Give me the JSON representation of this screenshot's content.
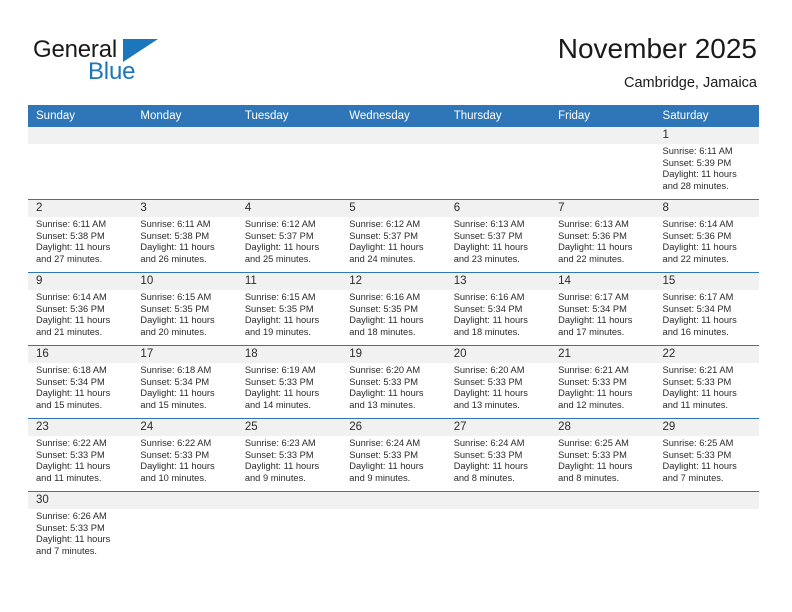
{
  "logo": {
    "word_one": "General",
    "word_two": "Blue",
    "triangle_color": "#1b76bc"
  },
  "header": {
    "title": "November 2025",
    "subtitle": "Cambridge, Jamaica",
    "accent_color": "#2e76b8",
    "band_color": "#f1f1f1"
  },
  "weekdays": [
    "Sunday",
    "Monday",
    "Tuesday",
    "Wednesday",
    "Thursday",
    "Friday",
    "Saturday"
  ],
  "labels": {
    "sunrise": "Sunrise:",
    "sunset": "Sunset:",
    "daylight": "Daylight:"
  },
  "weeks": [
    [
      {
        "day": "",
        "empty": true
      },
      {
        "day": "",
        "empty": true
      },
      {
        "day": "",
        "empty": true
      },
      {
        "day": "",
        "empty": true
      },
      {
        "day": "",
        "empty": true
      },
      {
        "day": "",
        "empty": true
      },
      {
        "day": "1",
        "sunrise": "Sunrise: 6:11 AM",
        "sunset": "Sunset: 5:39 PM",
        "daylight_a": "Daylight: 11 hours",
        "daylight_b": "and 28 minutes."
      }
    ],
    [
      {
        "day": "2",
        "sunrise": "Sunrise: 6:11 AM",
        "sunset": "Sunset: 5:38 PM",
        "daylight_a": "Daylight: 11 hours",
        "daylight_b": "and 27 minutes."
      },
      {
        "day": "3",
        "sunrise": "Sunrise: 6:11 AM",
        "sunset": "Sunset: 5:38 PM",
        "daylight_a": "Daylight: 11 hours",
        "daylight_b": "and 26 minutes."
      },
      {
        "day": "4",
        "sunrise": "Sunrise: 6:12 AM",
        "sunset": "Sunset: 5:37 PM",
        "daylight_a": "Daylight: 11 hours",
        "daylight_b": "and 25 minutes."
      },
      {
        "day": "5",
        "sunrise": "Sunrise: 6:12 AM",
        "sunset": "Sunset: 5:37 PM",
        "daylight_a": "Daylight: 11 hours",
        "daylight_b": "and 24 minutes."
      },
      {
        "day": "6",
        "sunrise": "Sunrise: 6:13 AM",
        "sunset": "Sunset: 5:37 PM",
        "daylight_a": "Daylight: 11 hours",
        "daylight_b": "and 23 minutes."
      },
      {
        "day": "7",
        "sunrise": "Sunrise: 6:13 AM",
        "sunset": "Sunset: 5:36 PM",
        "daylight_a": "Daylight: 11 hours",
        "daylight_b": "and 22 minutes."
      },
      {
        "day": "8",
        "sunrise": "Sunrise: 6:14 AM",
        "sunset": "Sunset: 5:36 PM",
        "daylight_a": "Daylight: 11 hours",
        "daylight_b": "and 22 minutes."
      }
    ],
    [
      {
        "day": "9",
        "sunrise": "Sunrise: 6:14 AM",
        "sunset": "Sunset: 5:36 PM",
        "daylight_a": "Daylight: 11 hours",
        "daylight_b": "and 21 minutes."
      },
      {
        "day": "10",
        "sunrise": "Sunrise: 6:15 AM",
        "sunset": "Sunset: 5:35 PM",
        "daylight_a": "Daylight: 11 hours",
        "daylight_b": "and 20 minutes."
      },
      {
        "day": "11",
        "sunrise": "Sunrise: 6:15 AM",
        "sunset": "Sunset: 5:35 PM",
        "daylight_a": "Daylight: 11 hours",
        "daylight_b": "and 19 minutes."
      },
      {
        "day": "12",
        "sunrise": "Sunrise: 6:16 AM",
        "sunset": "Sunset: 5:35 PM",
        "daylight_a": "Daylight: 11 hours",
        "daylight_b": "and 18 minutes."
      },
      {
        "day": "13",
        "sunrise": "Sunrise: 6:16 AM",
        "sunset": "Sunset: 5:34 PM",
        "daylight_a": "Daylight: 11 hours",
        "daylight_b": "and 18 minutes."
      },
      {
        "day": "14",
        "sunrise": "Sunrise: 6:17 AM",
        "sunset": "Sunset: 5:34 PM",
        "daylight_a": "Daylight: 11 hours",
        "daylight_b": "and 17 minutes."
      },
      {
        "day": "15",
        "sunrise": "Sunrise: 6:17 AM",
        "sunset": "Sunset: 5:34 PM",
        "daylight_a": "Daylight: 11 hours",
        "daylight_b": "and 16 minutes."
      }
    ],
    [
      {
        "day": "16",
        "sunrise": "Sunrise: 6:18 AM",
        "sunset": "Sunset: 5:34 PM",
        "daylight_a": "Daylight: 11 hours",
        "daylight_b": "and 15 minutes."
      },
      {
        "day": "17",
        "sunrise": "Sunrise: 6:18 AM",
        "sunset": "Sunset: 5:34 PM",
        "daylight_a": "Daylight: 11 hours",
        "daylight_b": "and 15 minutes."
      },
      {
        "day": "18",
        "sunrise": "Sunrise: 6:19 AM",
        "sunset": "Sunset: 5:33 PM",
        "daylight_a": "Daylight: 11 hours",
        "daylight_b": "and 14 minutes."
      },
      {
        "day": "19",
        "sunrise": "Sunrise: 6:20 AM",
        "sunset": "Sunset: 5:33 PM",
        "daylight_a": "Daylight: 11 hours",
        "daylight_b": "and 13 minutes."
      },
      {
        "day": "20",
        "sunrise": "Sunrise: 6:20 AM",
        "sunset": "Sunset: 5:33 PM",
        "daylight_a": "Daylight: 11 hours",
        "daylight_b": "and 13 minutes."
      },
      {
        "day": "21",
        "sunrise": "Sunrise: 6:21 AM",
        "sunset": "Sunset: 5:33 PM",
        "daylight_a": "Daylight: 11 hours",
        "daylight_b": "and 12 minutes."
      },
      {
        "day": "22",
        "sunrise": "Sunrise: 6:21 AM",
        "sunset": "Sunset: 5:33 PM",
        "daylight_a": "Daylight: 11 hours",
        "daylight_b": "and 11 minutes."
      }
    ],
    [
      {
        "day": "23",
        "sunrise": "Sunrise: 6:22 AM",
        "sunset": "Sunset: 5:33 PM",
        "daylight_a": "Daylight: 11 hours",
        "daylight_b": "and 11 minutes."
      },
      {
        "day": "24",
        "sunrise": "Sunrise: 6:22 AM",
        "sunset": "Sunset: 5:33 PM",
        "daylight_a": "Daylight: 11 hours",
        "daylight_b": "and 10 minutes."
      },
      {
        "day": "25",
        "sunrise": "Sunrise: 6:23 AM",
        "sunset": "Sunset: 5:33 PM",
        "daylight_a": "Daylight: 11 hours",
        "daylight_b": "and 9 minutes."
      },
      {
        "day": "26",
        "sunrise": "Sunrise: 6:24 AM",
        "sunset": "Sunset: 5:33 PM",
        "daylight_a": "Daylight: 11 hours",
        "daylight_b": "and 9 minutes."
      },
      {
        "day": "27",
        "sunrise": "Sunrise: 6:24 AM",
        "sunset": "Sunset: 5:33 PM",
        "daylight_a": "Daylight: 11 hours",
        "daylight_b": "and 8 minutes."
      },
      {
        "day": "28",
        "sunrise": "Sunrise: 6:25 AM",
        "sunset": "Sunset: 5:33 PM",
        "daylight_a": "Daylight: 11 hours",
        "daylight_b": "and 8 minutes."
      },
      {
        "day": "29",
        "sunrise": "Sunrise: 6:25 AM",
        "sunset": "Sunset: 5:33 PM",
        "daylight_a": "Daylight: 11 hours",
        "daylight_b": "and 7 minutes."
      }
    ],
    [
      {
        "day": "30",
        "sunrise": "Sunrise: 6:26 AM",
        "sunset": "Sunset: 5:33 PM",
        "daylight_a": "Daylight: 11 hours",
        "daylight_b": "and 7 minutes."
      },
      {
        "day": "",
        "empty": true
      },
      {
        "day": "",
        "empty": true
      },
      {
        "day": "",
        "empty": true
      },
      {
        "day": "",
        "empty": true
      },
      {
        "day": "",
        "empty": true
      },
      {
        "day": "",
        "empty": true
      }
    ]
  ]
}
